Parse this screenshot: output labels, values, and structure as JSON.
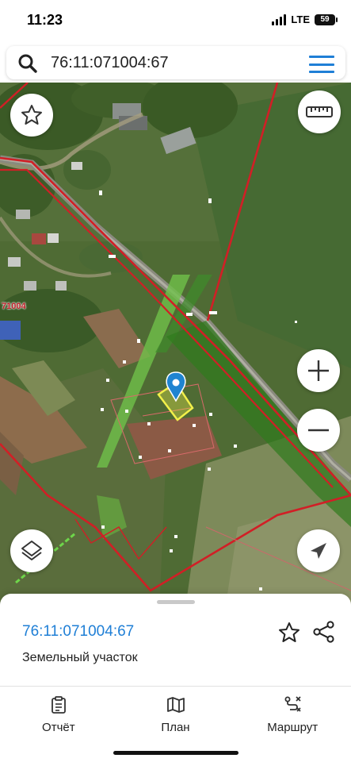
{
  "status_bar": {
    "time": "11:23",
    "network": "LTE",
    "battery": "59"
  },
  "search": {
    "value": "76:11:071004:67",
    "icon": "search-icon"
  },
  "map": {
    "quarter_label": "71004",
    "controls": [
      "favorite-star-icon",
      "ruler-icon",
      "zoom-in-icon",
      "zoom-out-icon",
      "layers-icon",
      "locate-arrow-icon"
    ],
    "zoom_in_symbol": "+",
    "zoom_out_symbol": "−",
    "colors": {
      "boundary": "#d11f26",
      "parcel_highlight": "#f2f04a",
      "pin": "#1f84d1",
      "zone_green": "#6fc04a"
    }
  },
  "sheet": {
    "cadastral_number": "76:11:071004:67",
    "object_type": "Земельный участок"
  },
  "tabs": [
    {
      "label": "Отчёт",
      "icon": "report-clipboard-icon"
    },
    {
      "label": "План",
      "icon": "map-plan-icon"
    },
    {
      "label": "Маршрут",
      "icon": "route-icon"
    }
  ]
}
